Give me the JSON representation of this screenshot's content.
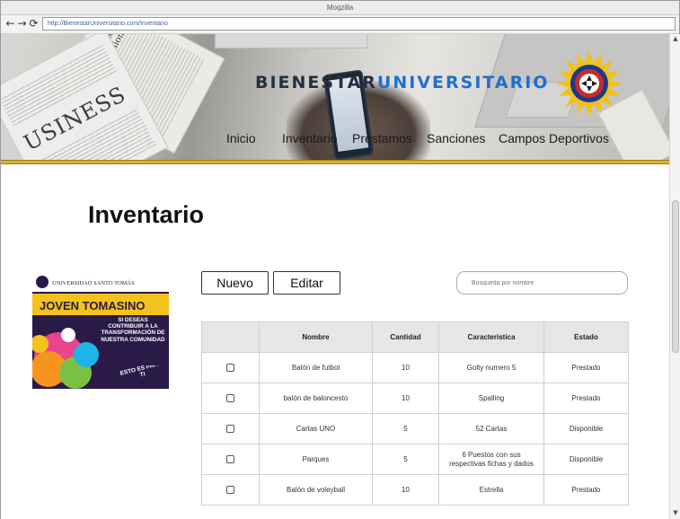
{
  "browser": {
    "title": "Moqzilla",
    "url": "http://BienestarUniversitario.com/Inventario",
    "back_icon": "←",
    "forward_icon": "→",
    "reload_icon": "⟳"
  },
  "header": {
    "brand_part1": "BIENESTAR",
    "brand_part2": "UNIVERSITARIO",
    "nav": [
      "Inicio",
      "Inventario",
      "Prestamos",
      "Sanciones",
      "Campos Deportivos"
    ]
  },
  "colors": {
    "accent": "#1f6fd0",
    "brand_dark": "#243040",
    "gold": "#d8b32d"
  },
  "page": {
    "title": "Inventario"
  },
  "promo": {
    "university": "UNIVERSIDAD SANTO TOMÁS",
    "heading": "JOVEN TOMASINO",
    "message": "SI DESEAS CONTRIBUIR A LA TRANSFORMACIÓN DE NUESTRA COMUNIDAD",
    "tagline": "ESTO ES PARA TI"
  },
  "actions": {
    "new_label": "Nuevo",
    "edit_label": "Editar",
    "search_placeholder": "Búsqueda por nombre"
  },
  "table": {
    "columns": [
      "",
      "Nombre",
      "Cantidad",
      "Característica",
      "Estado"
    ],
    "rows": [
      {
        "nombre": "Balón de futbol",
        "cantidad": "10",
        "caracteristica": "Golty numero 5",
        "estado": "Prestado"
      },
      {
        "nombre": "balón de baloncesto",
        "cantidad": "10",
        "caracteristica": "Spalling",
        "estado": "Prestado"
      },
      {
        "nombre": "Cartas UNO",
        "cantidad": "5",
        "caracteristica": "52 Cartas",
        "estado": "Disponible"
      },
      {
        "nombre": "Parques",
        "cantidad": "5",
        "caracteristica": "6 Puestos con sus respectivas fichas y dados",
        "estado": "Disponible"
      },
      {
        "nombre": "Balón de voleyball",
        "cantidad": "10",
        "caracteristica": "Estrella",
        "estado": "Prestado"
      }
    ]
  }
}
